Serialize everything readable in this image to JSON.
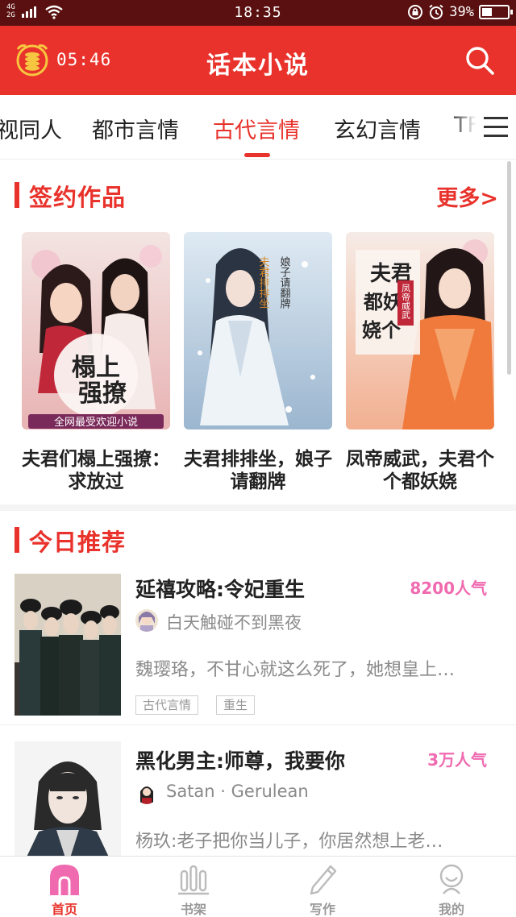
{
  "status_bar": {
    "network": "4G",
    "network2": "2G",
    "time": "18:35",
    "battery": "39%",
    "battery_level": 0.39
  },
  "header": {
    "countdown": "05:46",
    "title": "话本小说"
  },
  "tabs": [
    "视同人",
    "都市言情",
    "古代言情",
    "玄幻言情",
    "TF"
  ],
  "active_tab": "古代言情",
  "signed": {
    "title": "签约作品",
    "more": "更多>",
    "books": [
      {
        "title": "夫君们榻上强撩：求放过",
        "cover_text": "榻上强撩",
        "cover_banner": "全网最受欢迎小说"
      },
      {
        "title": "夫君排排坐，娘子请翻牌",
        "cover_text": "夫君排排坐",
        "cover_banner": ""
      },
      {
        "title": "凤帝威武，夫君个个都妖娆",
        "cover_text": "夫君个个都妖娆",
        "cover_banner": ""
      }
    ]
  },
  "recommend": {
    "title": "今日推荐",
    "items": [
      {
        "title": "延禧攻略:令妃重生",
        "popularity": "8200人气",
        "author": "白天触碰不到黑夜",
        "desc": "魏璎珞，不甘心就这么死了，她想皇上…",
        "tags": [
          "古代言情",
          "重生"
        ]
      },
      {
        "title": "黑化男主:师尊，我要你",
        "popularity": "3万人气",
        "author": "Satan · Gerulean",
        "desc": "杨玖:老子把你当儿子，你居然想上老…",
        "tags": []
      }
    ]
  },
  "bottom_nav": [
    {
      "label": "首页",
      "icon": "home-icon",
      "active": true
    },
    {
      "label": "书架",
      "icon": "bookshelf-icon",
      "active": false
    },
    {
      "label": "写作",
      "icon": "pen-icon",
      "active": false
    },
    {
      "label": "我的",
      "icon": "profile-icon",
      "active": false
    }
  ],
  "colors": {
    "brand": "#e8322b",
    "popularity": "#f06ab0",
    "muted": "#8a8a8a"
  }
}
